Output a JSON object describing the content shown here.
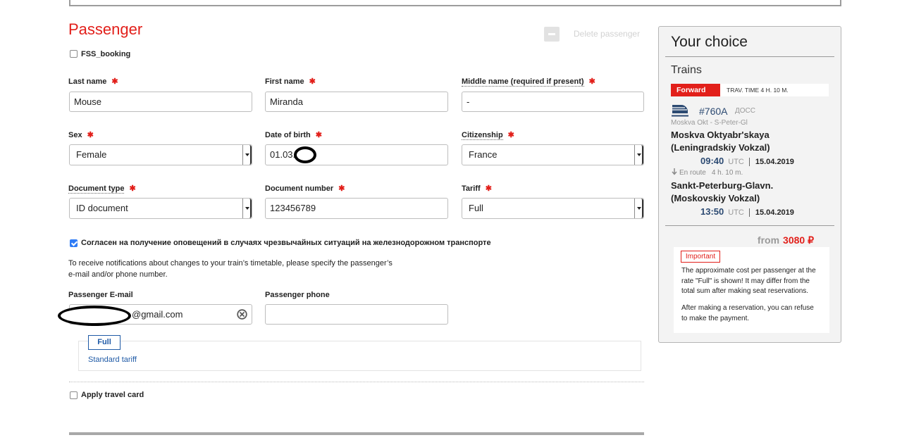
{
  "colors": {
    "accent": "#e21f1a",
    "link": "#1f5aa6",
    "train": "#2c4a72",
    "check": "#2f7cf6",
    "muted": "#9a9a9a"
  },
  "icons": {
    "delete": "minus-icon",
    "select": "chevron-down-icon",
    "clear": "clear-circle-icon",
    "train": "train-icon",
    "en_route": "arrow-down-icon"
  },
  "passenger": {
    "title": "Passenger",
    "delete_label": "Delete passenger",
    "fss_booking_label": "FSS_booking",
    "fss_booking_checked": false,
    "required_mark": "✱",
    "fields": {
      "last_name": {
        "label": "Last name",
        "value": "Mouse"
      },
      "first_name": {
        "label": "First name",
        "value": "Miranda"
      },
      "middle_name": {
        "label": "Middle name (required if present)",
        "value": "-"
      },
      "sex": {
        "label": "Sex",
        "value": "Female"
      },
      "date_of_birth": {
        "label": "Date of birth",
        "value": "01.03."
      },
      "citizenship": {
        "label": "Citizenship",
        "value": "France"
      },
      "document_type": {
        "label": "Document type",
        "value": "ID document"
      },
      "document_number": {
        "label": "Document number",
        "value": "123456789"
      },
      "tariff": {
        "label": "Tariff",
        "value": "Full"
      }
    },
    "consent_label": "Согласен на получение оповещений в случаях чрезвычайных ситуаций на железнодорожном транспорте",
    "consent_checked": true,
    "notify_hint_line1": "To receive notifications about changes to your train’s timetable, please specify the passenger’s",
    "notify_hint_line2": "e-mail and/or phone number.",
    "email": {
      "label": "Passenger E-mail",
      "value": "@gmail.com"
    },
    "phone": {
      "label": "Passenger phone",
      "value": ""
    },
    "tariff_tab": {
      "label": "Full",
      "link": "Standard tariff"
    },
    "travel_card_label": "Apply travel card",
    "travel_card_checked": false
  },
  "summary": {
    "title": "Your choice",
    "section": "Trains",
    "direction_badge": "Forward",
    "travel_time": "TRAV. TIME 4 H. 10 M.",
    "train_number": "#760A",
    "train_class": "ДОСС",
    "route": "Moskva Okt - S-Peter-Gl",
    "departure": {
      "station_line1": "Moskva Oktyabr'skaya",
      "station_line2": "(Leningradskiy Vokzal)",
      "time": "09:40",
      "tz": "UTC",
      "date": "15.04.2019"
    },
    "en_route_label": "En route",
    "en_route_duration": "4 h. 10 m.",
    "arrival": {
      "station_line1": "Sankt-Peterburg-Glavn.",
      "station_line2": "(Moskovskiy Vokzal)",
      "time": "13:50",
      "tz": "UTC",
      "date": "15.04.2019"
    },
    "price_prefix": "from",
    "price": "3080 ₽",
    "important_label": "Important",
    "note1_lines": [
      "The approximate cost per passenger at the",
      "rate \"Full\" is shown! It may differ from the",
      "total sum after making seat reservations."
    ],
    "note2_lines": [
      "After making a reservation, you can refuse",
      "to make the payment."
    ]
  }
}
